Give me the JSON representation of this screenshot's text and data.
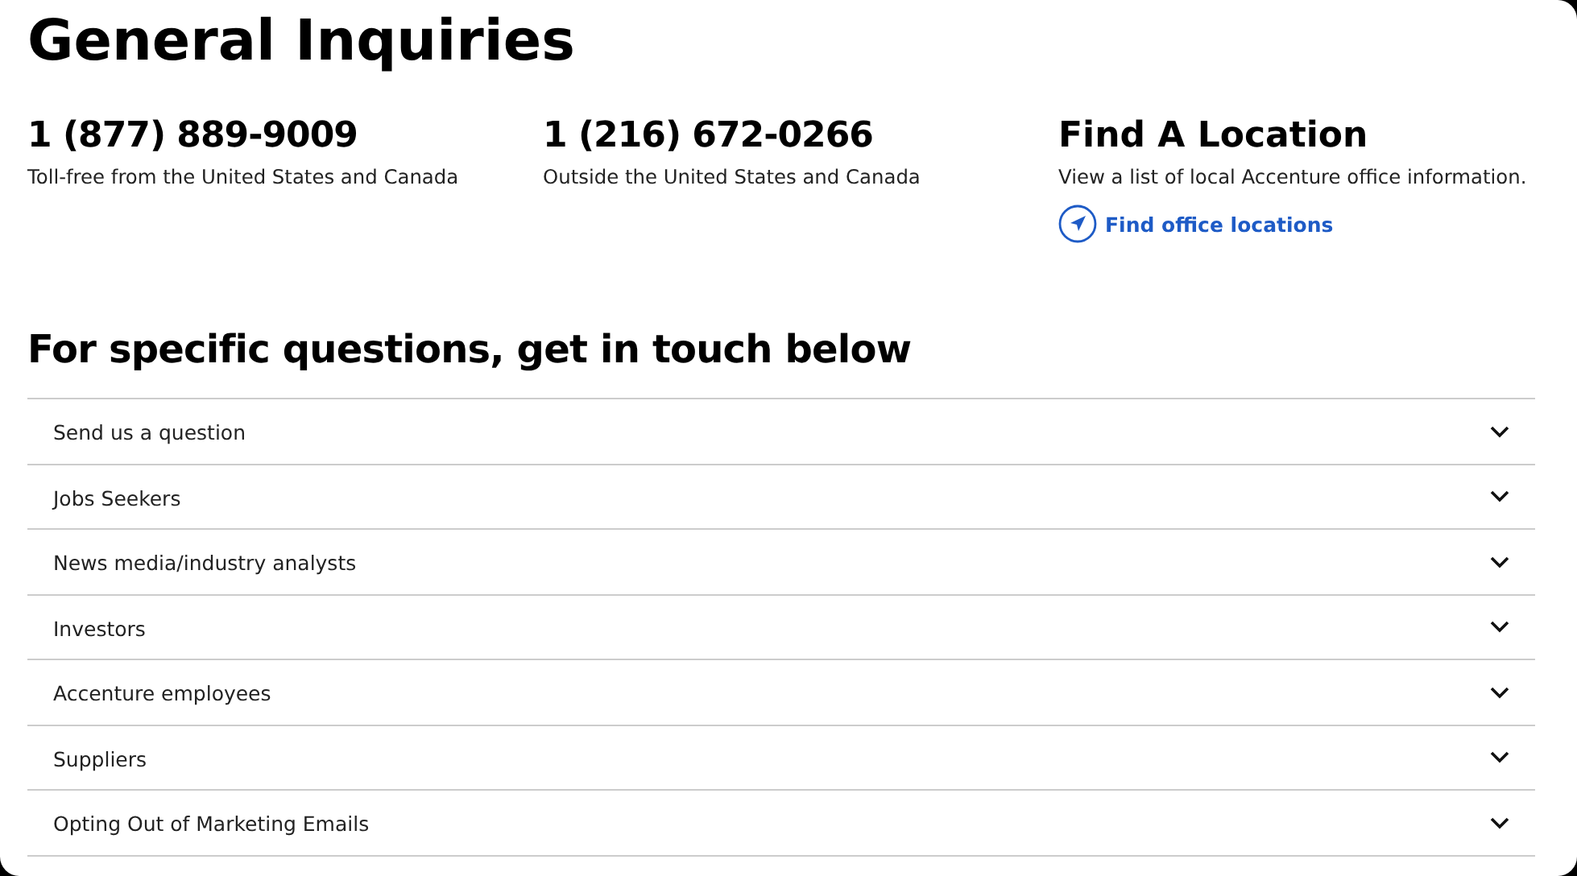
{
  "title": "General Inquiries",
  "contacts": [
    {
      "kind": "phone",
      "heading": "1 (877) 889-9009",
      "description": "Toll-free from the United States and Canada"
    },
    {
      "kind": "phone",
      "heading": "1 (216) 672-0266",
      "description": "Outside the United States and Canada"
    },
    {
      "kind": "location",
      "heading": "Find A Location",
      "description": "View a list of local Accenture office information.",
      "link": "Find office locations"
    }
  ],
  "section_title": "For specific questions, get in touch below",
  "accordion": [
    {
      "label": "Send us a question",
      "expanded": false
    },
    {
      "label": "Jobs Seekers",
      "expanded": false
    },
    {
      "label": "News media/industry analysts",
      "expanded": false
    },
    {
      "label": "Investors",
      "expanded": false
    },
    {
      "label": "Accenture employees",
      "expanded": false
    },
    {
      "label": "Suppliers",
      "expanded": false
    },
    {
      "label": "Opting Out of Marketing Emails",
      "expanded": false
    }
  ]
}
